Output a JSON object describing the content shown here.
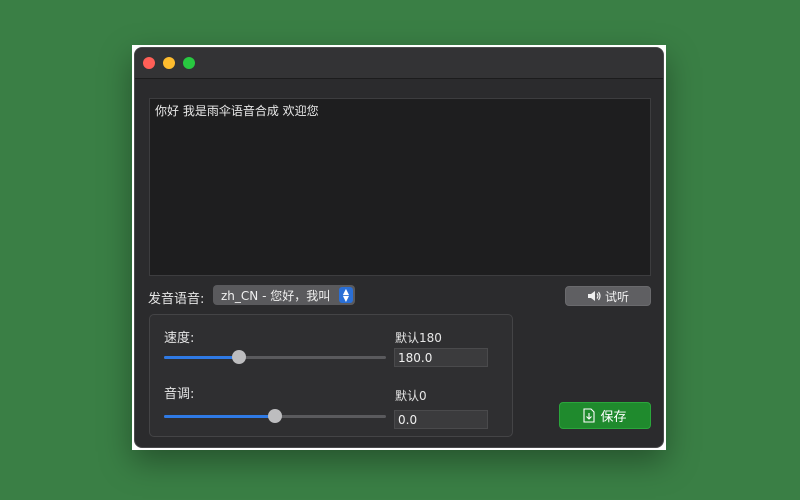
{
  "editor": {
    "text": "你好 我是雨伞语音合成 欢迎您"
  },
  "voice": {
    "label": "发音语音:",
    "selected": "zh_CN  -  您好，我叫"
  },
  "listen_button": {
    "label": "试听",
    "icon": "speaker-icon"
  },
  "speed": {
    "label": "速度:",
    "default_label": "默认180",
    "value": "180.0",
    "slider_fraction": 0.34
  },
  "pitch": {
    "label": "音调:",
    "default_label": "默认0",
    "value": "0.0",
    "slider_fraction": 0.5
  },
  "save_button": {
    "label": "保存",
    "icon": "file-download-icon",
    "color": "#1f8a2d"
  },
  "colors": {
    "accent": "#2f7ae5",
    "background": "#3a7f45"
  }
}
